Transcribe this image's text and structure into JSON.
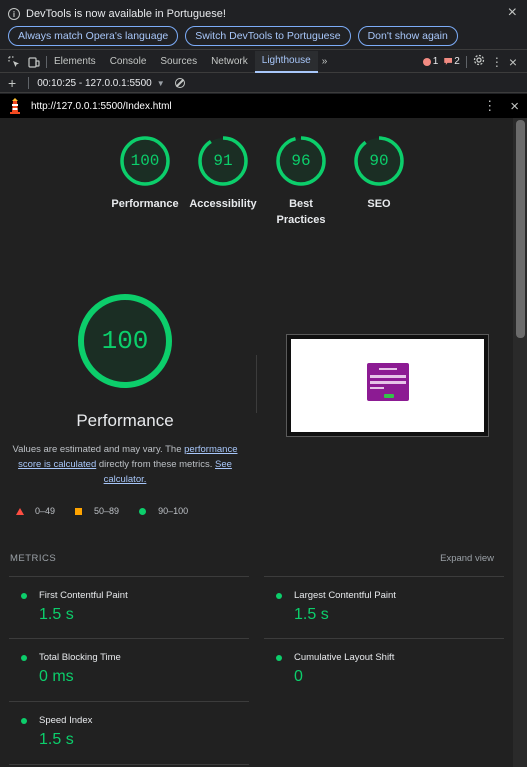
{
  "infobar": {
    "message": "DevTools is now available in Portuguese!",
    "buttons": [
      "Always match Opera's language",
      "Switch DevTools to Portuguese",
      "Don't show again"
    ],
    "close": "×"
  },
  "tabs": {
    "items": [
      "Elements",
      "Console",
      "Sources",
      "Network",
      "Lighthouse"
    ],
    "active": "Lighthouse",
    "more": "»",
    "error_count": "1",
    "warning_count": "2"
  },
  "report_bar": {
    "plus": "+",
    "selected_report": "00:10:25 - 127.0.0.1:5500"
  },
  "url_bar": {
    "url": "http://127.0.0.1:5500/Index.html",
    "kebab": "⋮",
    "close": "×"
  },
  "scores": [
    {
      "label": "Performance",
      "score": "100",
      "fraction": 1.0
    },
    {
      "label": "Accessibility",
      "score": "91",
      "fraction": 0.91
    },
    {
      "label": "Best Practices",
      "score": "96",
      "fraction": 0.96
    },
    {
      "label": "SEO",
      "score": "90",
      "fraction": 0.9
    }
  ],
  "performance": {
    "score": "100",
    "fraction": 1.0,
    "title": "Performance",
    "desc_prefix": "Values are estimated and may vary. The ",
    "desc_link1": "performance score is calculated",
    "desc_mid": " directly from these metrics. ",
    "desc_link2": "See calculator."
  },
  "legend": {
    "fail": "0–49",
    "average": "50–89",
    "pass": "90–100"
  },
  "metrics": {
    "heading": "METRICS",
    "expand": "Expand view",
    "items": [
      {
        "name": "First Contentful Paint",
        "value": "1.5 s"
      },
      {
        "name": "Largest Contentful Paint",
        "value": "1.5 s"
      },
      {
        "name": "Total Blocking Time",
        "value": "0 ms"
      },
      {
        "name": "Cumulative Layout Shift",
        "value": "0"
      },
      {
        "name": "Speed Index",
        "value": "1.5 s"
      }
    ]
  },
  "colors": {
    "pass": "#0cce6b",
    "average": "#ffa400",
    "fail": "#ff4e42",
    "link": "#a8c7fa"
  }
}
